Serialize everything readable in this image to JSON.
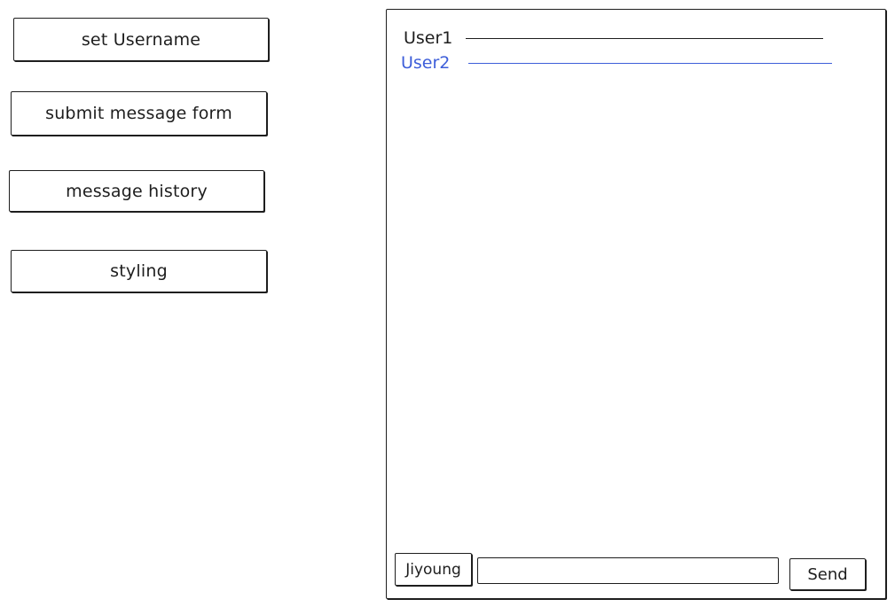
{
  "features": {
    "set_username": "set Username",
    "submit_message_form": "submit message form",
    "message_history": "message history",
    "styling": "styling"
  },
  "chat": {
    "messages": [
      {
        "user": "User1",
        "color": "#1e1e1e"
      },
      {
        "user": "User2",
        "color": "#3d5ed9"
      }
    ],
    "composer": {
      "username": "Jiyoung",
      "input_value": "",
      "send_label": "Send"
    }
  }
}
